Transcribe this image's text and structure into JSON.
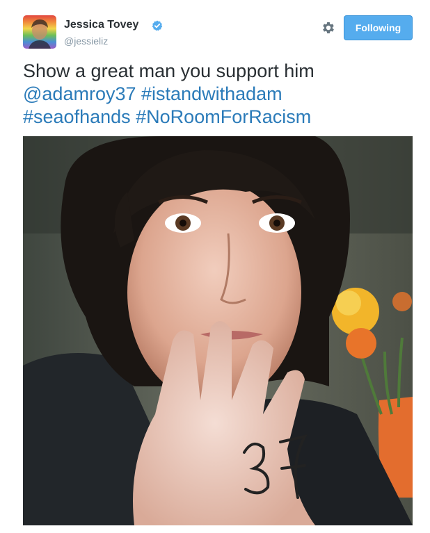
{
  "author": {
    "name": "Jessica Tovey",
    "handle": "@jessieliz",
    "verified": true,
    "avatar_icon": "rainbow-avatar"
  },
  "actions": {
    "settings_icon": "gear-icon",
    "follow_label": "Following",
    "follow_color": "#55acee"
  },
  "tweet": {
    "text_plain": "Show a great man you support him",
    "mention": "@adamroy37",
    "hashtags": [
      "#istandwithadam",
      "#seaofhands",
      "#NoRoomForRacism"
    ],
    "link_color": "#2b7bb9"
  },
  "media": {
    "photo_icon": "selfie-photo",
    "hand_text": "37"
  }
}
